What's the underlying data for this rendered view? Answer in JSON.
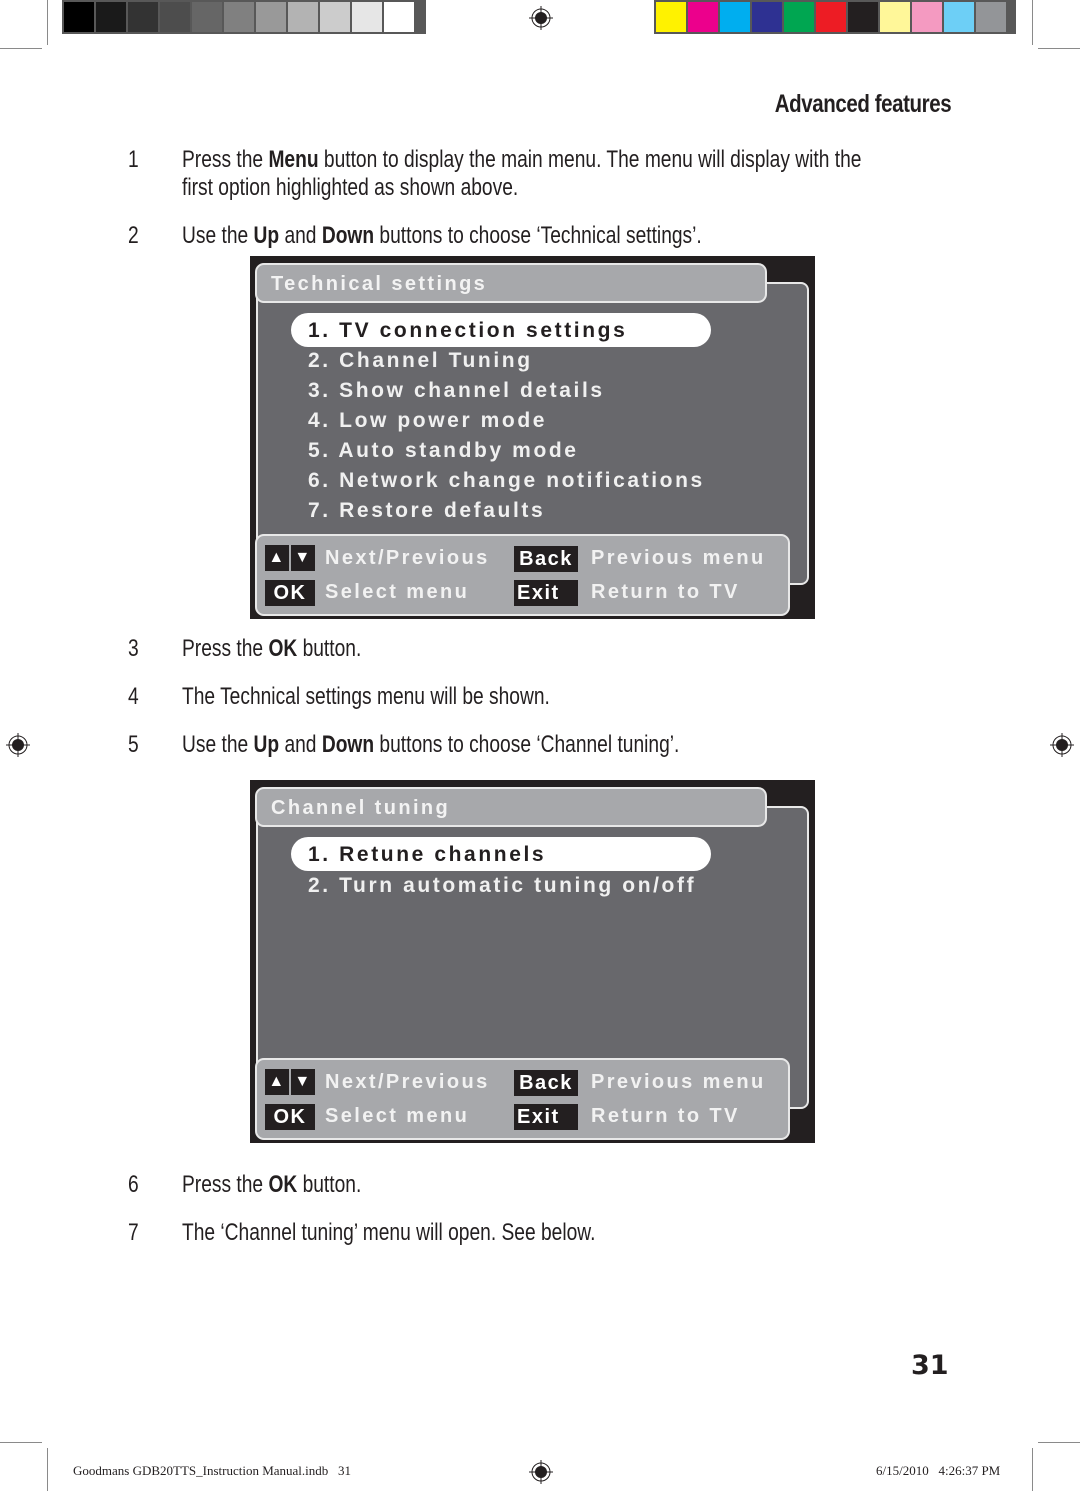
{
  "print_marks": {
    "gray_swatches": [
      "#000000",
      "#1a1a1a",
      "#333333",
      "#4d4d4d",
      "#666666",
      "#808080",
      "#999999",
      "#b3b3b3",
      "#cccccc",
      "#e6e6e6",
      "#ffffff"
    ],
    "color_swatches": [
      "#fff200",
      "#ec008c",
      "#00aeef",
      "#2e3192",
      "#00a651",
      "#ed1c24",
      "#231f20",
      "#fff799",
      "#f49ac1",
      "#6dcff6",
      "#939598"
    ]
  },
  "header": {
    "section_title": "Advanced features"
  },
  "steps": [
    {
      "num": "1",
      "parts": [
        {
          "t": "Press the "
        },
        {
          "b": "Menu"
        },
        {
          "t": " button to display the main menu. The menu will display with the first option highlighted as shown above."
        }
      ]
    },
    {
      "num": "2",
      "parts": [
        {
          "t": "Use the "
        },
        {
          "b": "Up"
        },
        {
          "t": " and "
        },
        {
          "b": "Down"
        },
        {
          "t": " buttons to choose ‘Technical settings’."
        }
      ]
    },
    {
      "num": "3",
      "parts": [
        {
          "t": "Press the "
        },
        {
          "b": "OK"
        },
        {
          "t": " button."
        }
      ]
    },
    {
      "num": "4",
      "parts": [
        {
          "t": "The Technical settings menu will be shown."
        }
      ]
    },
    {
      "num": "5",
      "parts": [
        {
          "t": "Use the "
        },
        {
          "b": "Up"
        },
        {
          "t": " and "
        },
        {
          "b": "Down"
        },
        {
          "t": " buttons to choose ‘Channel tuning’."
        }
      ]
    },
    {
      "num": "6",
      "parts": [
        {
          "t": "Press the "
        },
        {
          "b": "OK"
        },
        {
          "t": " button."
        }
      ]
    },
    {
      "num": "7",
      "parts": [
        {
          "t": "The ‘Channel tuning’ menu will open. See below."
        }
      ]
    }
  ],
  "menus": [
    {
      "title": "Technical settings",
      "selected_index": 0,
      "items": [
        "1. TV connection settings",
        "2. Channel Tuning",
        "3. Show channel details",
        "4. Low power mode",
        "5. Auto standby mode",
        "6. Network change notifications",
        "7. Restore defaults"
      ]
    },
    {
      "title": "Channel tuning",
      "selected_index": 0,
      "items": [
        "1. Retune channels",
        "2. Turn automatic tuning on/off"
      ]
    }
  ],
  "menu_footer": {
    "up_key": "▲",
    "down_key": "▼",
    "next_previous": "Next/Previous",
    "back_key": "Back",
    "previous_menu": "Previous menu",
    "ok_key": "OK",
    "select_menu": "Select menu",
    "exit_key": "Exit",
    "return_to_tv": "Return to TV"
  },
  "page_number": "31",
  "footer": {
    "file_info": "Goodmans GDB20TTS_Instruction Manual.indb   31",
    "timestamp": "6/15/2010   4:26:37 PM"
  }
}
